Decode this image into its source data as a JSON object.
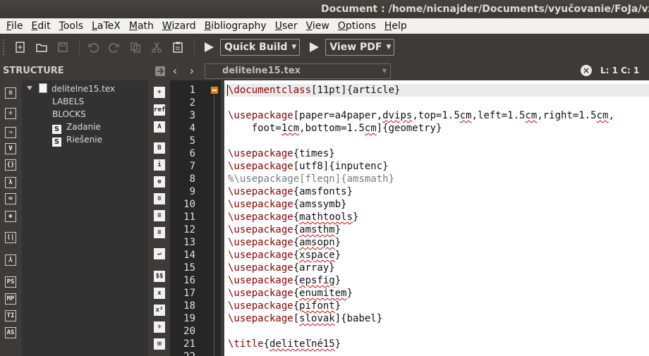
{
  "window": {
    "title": "Document : /home/nicnajder/Documents/vyučovanie/FoJa/vzorák"
  },
  "menu": [
    {
      "u": "F",
      "rest": "ile"
    },
    {
      "u": "E",
      "rest": "dit"
    },
    {
      "u": "T",
      "rest": "ools"
    },
    {
      "u": "L",
      "rest": "aTeX"
    },
    {
      "u": "M",
      "rest": "ath"
    },
    {
      "u": "W",
      "rest": "izard"
    },
    {
      "u": "B",
      "rest": "ibliography"
    },
    {
      "u": "U",
      "rest": "ser"
    },
    {
      "u": "V",
      "rest": "iew"
    },
    {
      "u": "O",
      "rest": "ptions"
    },
    {
      "u": "H",
      "rest": "elp"
    }
  ],
  "toolbar": {
    "quick_build": "Quick Build",
    "view_pdf": "View PDF"
  },
  "structure": {
    "header": "STRUCTURE",
    "file": "delitelne15.tex",
    "labels": "LABELS",
    "blocks": "BLOCKS",
    "items": [
      "Zadanie",
      "Riešenie"
    ]
  },
  "editor": {
    "file_name": "delitelne15.tex",
    "cursor_pos": "L: 1 C: 1",
    "line_numbers": [
      "1",
      "2",
      "3",
      "4",
      "5",
      "6",
      "7",
      "8",
      "9",
      "10",
      "11",
      "12",
      "13",
      "14",
      "15",
      "16",
      "17",
      "18",
      "19",
      "20",
      "21",
      "22"
    ]
  },
  "left_icons": [
    "≡",
    "÷",
    "⇒",
    "∀",
    "{}",
    "λ",
    "∞",
    "✱",
    "(|",
    "⅄",
    "PS",
    "MP",
    "TI",
    "AS"
  ],
  "sym_icons": [
    "+",
    "ref",
    "A",
    "B",
    "i",
    "e",
    "≡",
    "≡",
    "≡",
    "↵",
    "$$",
    "x",
    "x²",
    "÷",
    "⊞"
  ],
  "colors": {
    "accent": "#f08000",
    "command": "#8b0000",
    "comment": "#7a7a7a",
    "misspell": "#e00000"
  }
}
